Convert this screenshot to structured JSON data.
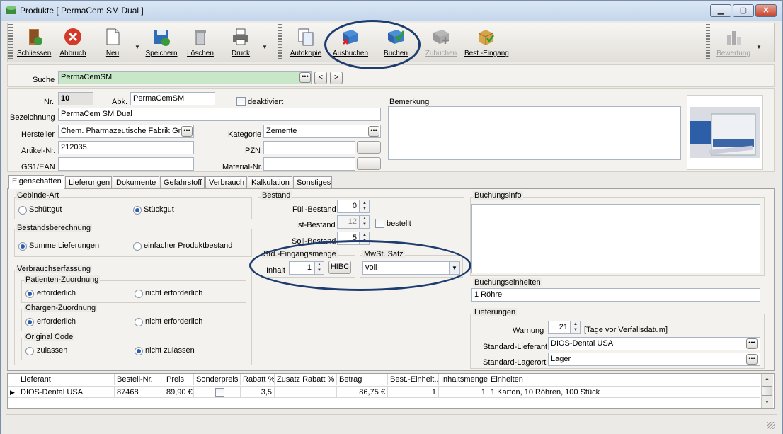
{
  "window": {
    "title": "Produkte [ PermaCem SM Dual ]",
    "btn_min": "▁",
    "btn_max": "▢",
    "btn_close": "✕"
  },
  "toolbar": {
    "items": [
      {
        "label": "Schliessen",
        "icon": "exit-door-icon"
      },
      {
        "label": "Abbruch",
        "icon": "cancel-icon"
      },
      {
        "label": "Neu",
        "icon": "new-document-icon"
      },
      {
        "label": "Speichern",
        "icon": "save-disk-icon"
      },
      {
        "label": "Löschen",
        "icon": "trash-icon"
      },
      {
        "label": "Druck",
        "icon": "printer-icon"
      },
      {
        "label": "Autokopie",
        "icon": "copy-icon"
      },
      {
        "label": "Ausbuchen",
        "icon": "book-remove-icon"
      },
      {
        "label": "Buchen",
        "icon": "book-add-icon"
      },
      {
        "label": "Zubuchen",
        "icon": "book-plus-icon"
      },
      {
        "label": "Best.-Eingang",
        "icon": "package-icon"
      },
      {
        "label": "Bewertung",
        "icon": "rating-chart-icon"
      }
    ],
    "dropdown_arrow": "▼"
  },
  "search": {
    "label": "Suche",
    "value": "PermaCemSM|",
    "prev": "<",
    "next": ">",
    "dots": "•••"
  },
  "product": {
    "nr_label": "Nr.",
    "nr": "10",
    "abk_label": "Abk.",
    "abk": "PermaCemSM",
    "deaktiviert_label": "deaktiviert",
    "bezeichnung_label": "Bezeichnung",
    "bezeichnung": "PermaCem SM Dual",
    "hersteller_label": "Hersteller",
    "hersteller": "Chem. Pharmazeutische Fabrik Gmb",
    "kategorie_label": "Kategorie",
    "kategorie": "Zemente",
    "artikel_label": "Artikel-Nr.",
    "artikel": "212035",
    "pzn_label": "PZN",
    "pzn": "",
    "gs1_label": "GS1/EAN",
    "gs1": "",
    "material_label": "Material-Nr.",
    "material": "",
    "bemerkung_label": "Bemerkung",
    "bemerkung": ""
  },
  "tabs": [
    "Eigenschaften",
    "Lieferungen",
    "Dokumente",
    "Gefahrstoff",
    "Verbrauch",
    "Kalkulation",
    "Sonstiges"
  ],
  "eigenschaften": {
    "gebinde_title": "Gebinde-Art",
    "schuettgut": "Schüttgut",
    "stueckgut": "Stückgut",
    "bestand_title": "Bestandsberechnung",
    "summe": "Summe Lieferungen",
    "einfacher": "einfacher Produktbestand",
    "verbrauch_title": "Verbrauchserfassung",
    "patienten_title": "Patienten-Zuordnung",
    "erforderlich1": "erforderlich",
    "nicht_erforderlich1": "nicht erforderlich",
    "chargen_title": "Chargen-Zuordnung",
    "erforderlich2": "erforderlich",
    "nicht_erforderlich2": "nicht erforderlich",
    "original_title": "Original Code",
    "zulassen": "zulassen",
    "nicht_zulassen": "nicht zulassen"
  },
  "bestand": {
    "title": "Bestand",
    "fuell_label": "Füll-Bestand",
    "fuell": "0",
    "ist_label": "Ist-Bestand",
    "ist": "12",
    "bestellt_label": "bestellt",
    "soll_label": "Soll-Bestand",
    "soll": "5",
    "std_title": "Std.-Eingangsmenge",
    "inhalt_label": "Inhalt",
    "inhalt": "1",
    "hibc": "HIBC",
    "mwst_title": "MwSt. Satz",
    "mwst": "voll"
  },
  "buchung": {
    "info_title": "Buchungsinfo",
    "einheiten_title": "Buchungseinheiten",
    "einheiten": "1 Röhre",
    "lieferungen_title": "Lieferungen",
    "warnung_label": "Warnung",
    "warnung": "21",
    "warnung_suffix": "[Tage vor Verfallsdatum]",
    "lieferant_label": "Standard-Lieferant",
    "lieferant": "DIOS-Dental USA",
    "lagerort_label": "Standard-Lagerort",
    "lagerort": "Lager"
  },
  "grid": {
    "headers": [
      "Lieferant",
      "Bestell-Nr.",
      "Preis",
      "Sonderpreis",
      "Rabatt %",
      "Zusatz Rabatt %",
      "Betrag",
      "Best.-Einheit...",
      "Inhaltsmenge",
      "Einheiten"
    ],
    "row": {
      "lieferant": "DIOS-Dental USA",
      "bestell": "87468",
      "preis": "89,90 €",
      "rabatt": "3,5",
      "zusatz": "",
      "betrag": "86,75 €",
      "einheit": "1",
      "inhalt": "1",
      "einheiten": "1 Karton, 10 Röhren, 100 Stück"
    },
    "row_marker": "▶",
    "scroll_up": "▲",
    "scroll_down": "▼"
  },
  "colors": {
    "search_bg": "#c8e6c8",
    "annotation": "#1e3d6e"
  }
}
